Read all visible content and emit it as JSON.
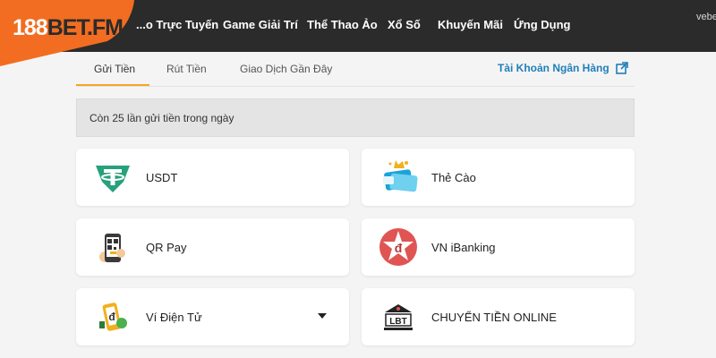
{
  "brand": {
    "logo_num": "188",
    "logo_bet": "BET.FM",
    "accent_color": "#f26d21"
  },
  "nav": {
    "items": [
      "...o Trực Tuyến",
      "Game Giải Trí",
      "Thể Thao Ảo",
      "Xổ Số",
      "Khuyến Mãi",
      "Ứng Dụng"
    ],
    "user": "vebe"
  },
  "tabs": {
    "items": [
      "Gửi Tiền",
      "Rút Tiền",
      "Giao Dịch Gần Đây"
    ],
    "active": "Gửi Tiền",
    "bank_link": "Tài Khoản Ngân Hàng"
  },
  "notice": "Còn 25 lần gửi tiền trong ngày",
  "methods": [
    {
      "label": "USDT",
      "icon": "tether-icon"
    },
    {
      "label": "Thẻ Cào",
      "icon": "scratch-card-icon"
    },
    {
      "label": "QR Pay",
      "icon": "qr-phone-icon"
    },
    {
      "label": "VN iBanking",
      "icon": "vn-banking-icon"
    },
    {
      "label": "Ví Điện Tử",
      "icon": "e-wallet-icon"
    },
    {
      "label": "CHUYỂN TIỀN ONLINE",
      "icon": "lbt-bank-icon"
    }
  ],
  "colors": {
    "topbar": "#2b2b2b",
    "link": "#1f7fb8",
    "tab_underline": "#f5a623",
    "tether": "#26a17b",
    "vn_banking": "#e05454"
  }
}
